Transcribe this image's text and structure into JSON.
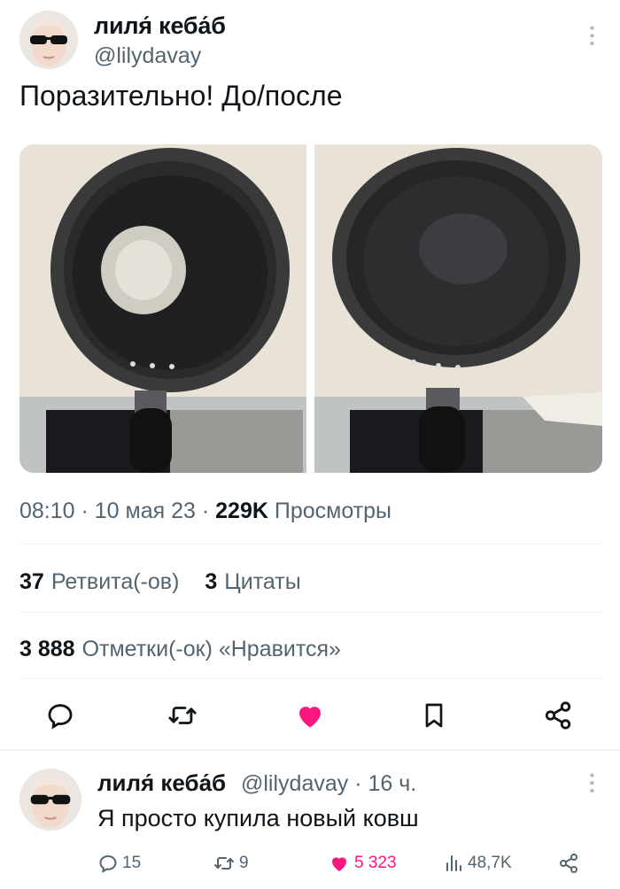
{
  "tweet": {
    "author_name": "лиля́ кеба́б",
    "author_handle": "@lilydavay",
    "text": "Поразительно! До/после",
    "time": "08:10 · 10 мая 23 · ",
    "views_count": "229K",
    "views_label": " Просмотры",
    "retweets_count": "37",
    "retweets_label": "Ретвита(-ов)",
    "quotes_count": "3",
    "quotes_label": "Цитаты",
    "likes_count": "3 888",
    "likes_label": "Отметки(-ок) «Нравится»"
  },
  "actions": {
    "reply": "reply-icon",
    "retweet": "retweet-icon",
    "like": "heart-icon",
    "bookmark": "bookmark-icon",
    "share": "share-icon"
  },
  "reply": {
    "author_name": "лиля́ кеба́б",
    "author_handle_time": "@lilydavay · 16 ч.",
    "text": "Я просто купила новый ковш",
    "reply_count": "15",
    "retweet_count": "9",
    "like_count": "5 323",
    "views_count": "48,7K"
  },
  "colors": {
    "accent_like": "#f91880",
    "secondary_text": "#536471",
    "divider": "#eff3f4"
  }
}
